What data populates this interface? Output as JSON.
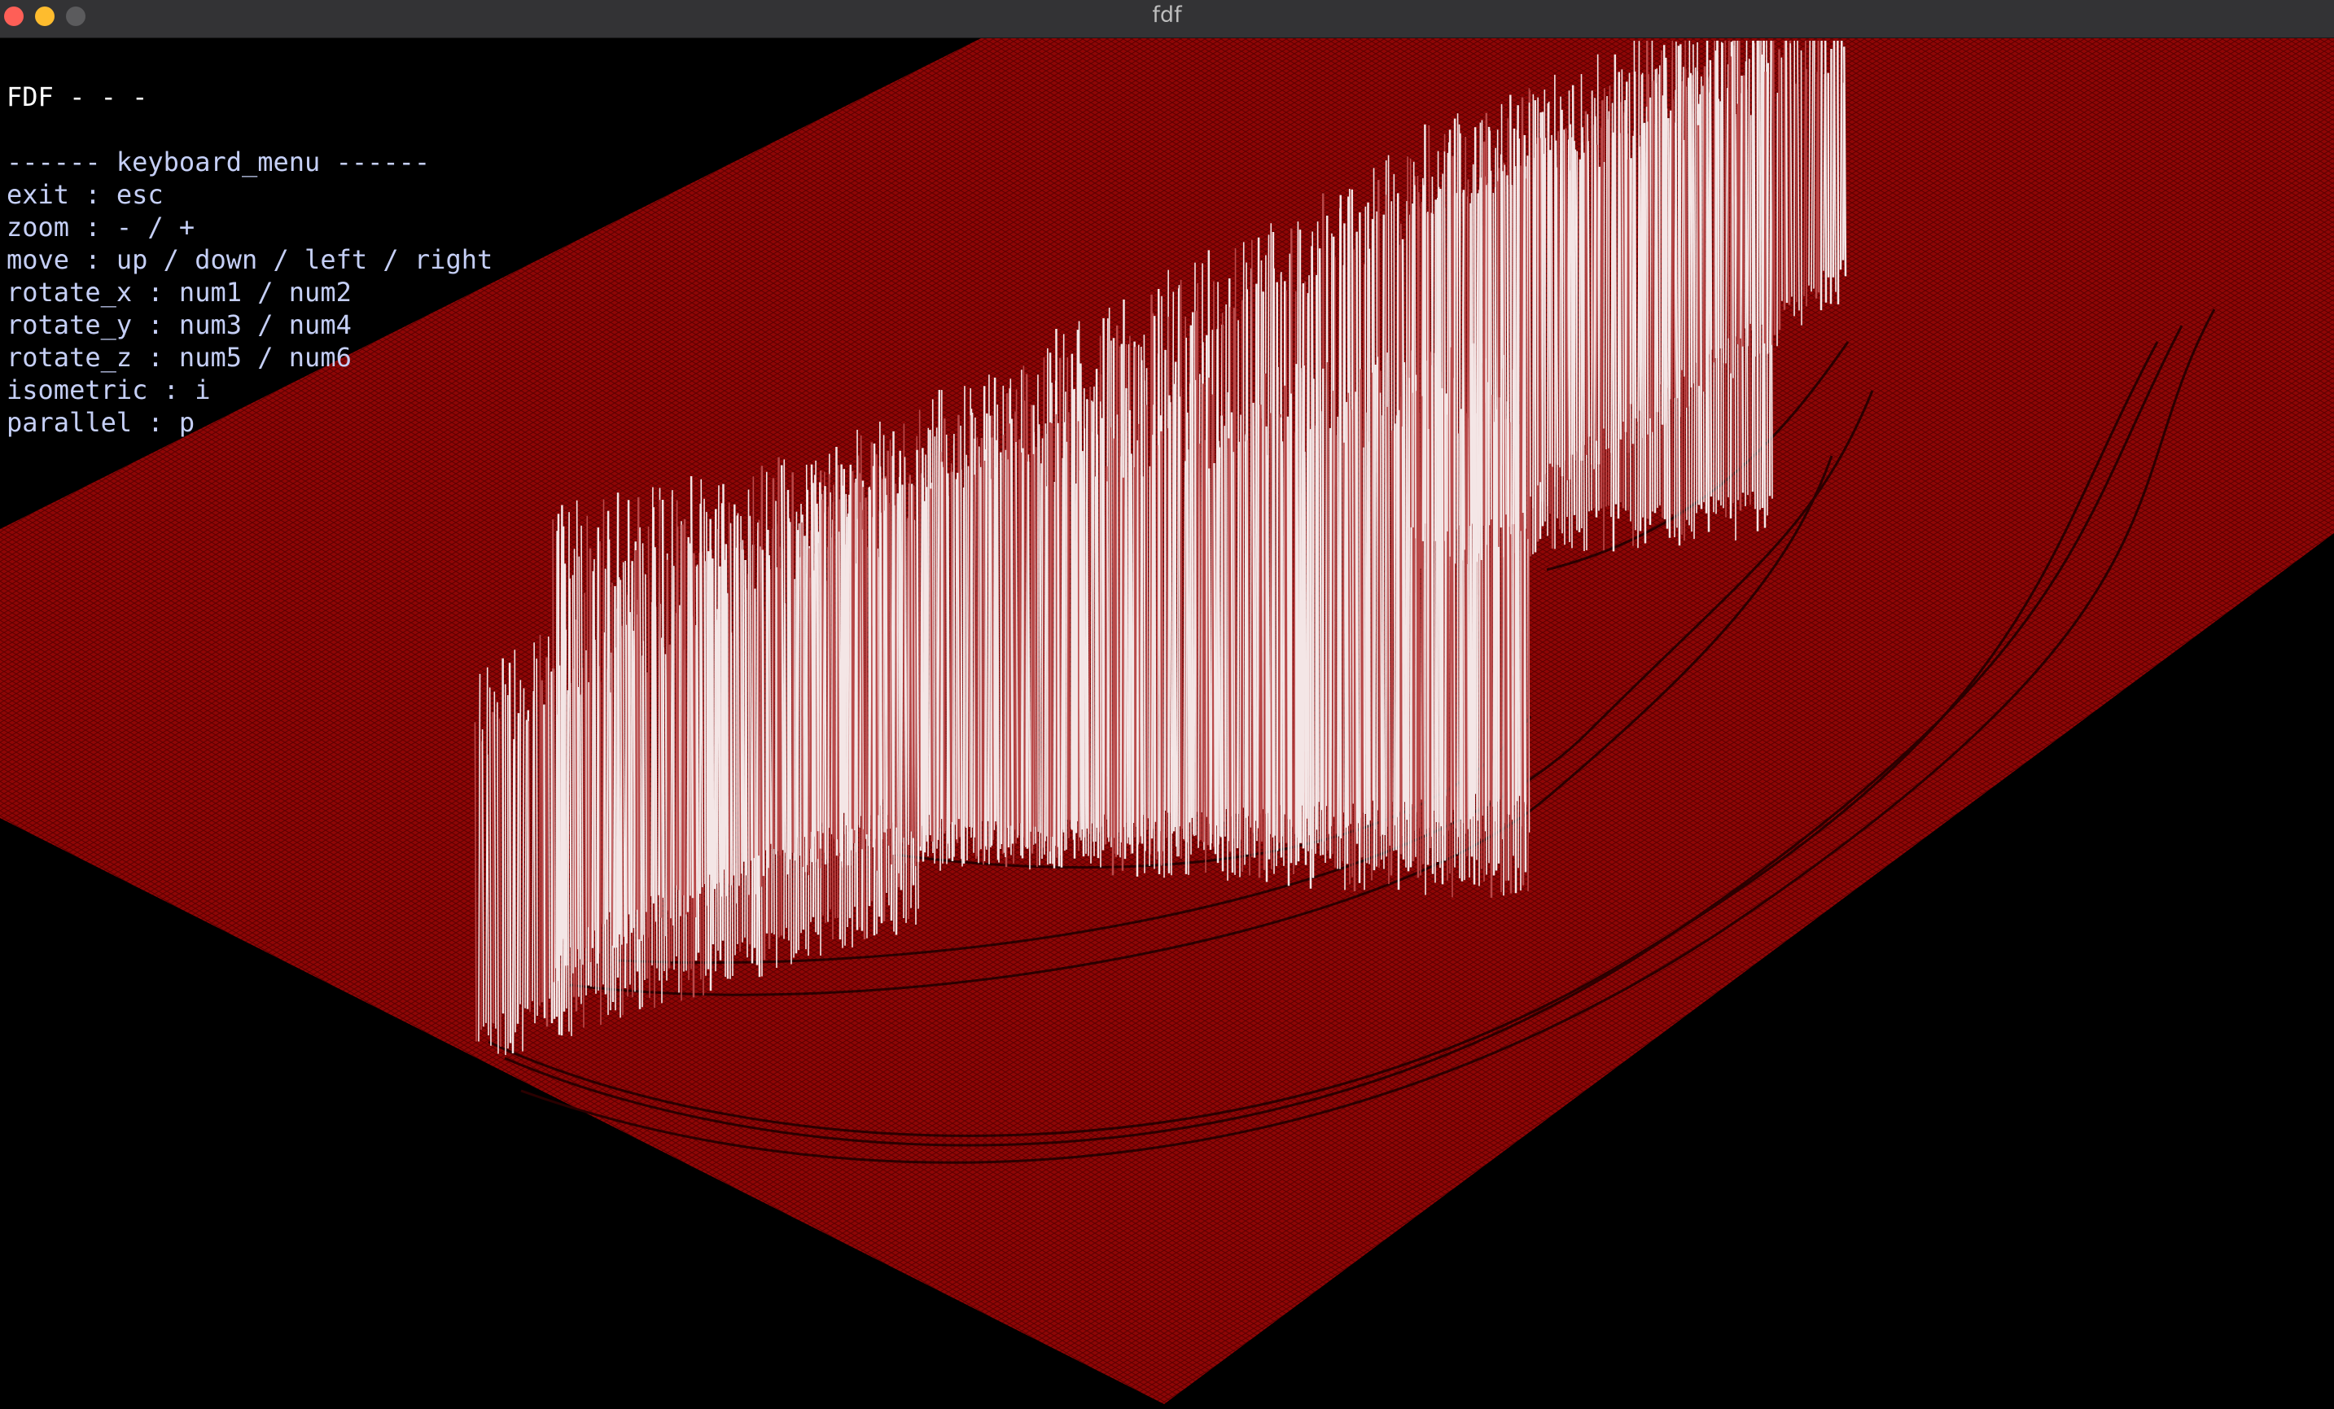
{
  "window": {
    "title": "fdf"
  },
  "overlay": {
    "heading": "FDF - - -",
    "menu_title": "------ keyboard_menu ------",
    "lines": [
      "exit : esc",
      "zoom : - / +",
      "move : up / down / left / right",
      "rotate_x : num1 / num2",
      "rotate_y : num3 / num4",
      "rotate_z : num5 / num6",
      "isometric : i",
      "parallel : p"
    ]
  },
  "colors": {
    "background": "#000000",
    "plane": "#8b0000",
    "grid": "#5a0000",
    "peak_low": "#b03030",
    "peak_high": "#ffffff",
    "menu_text": "#c5cff6"
  }
}
